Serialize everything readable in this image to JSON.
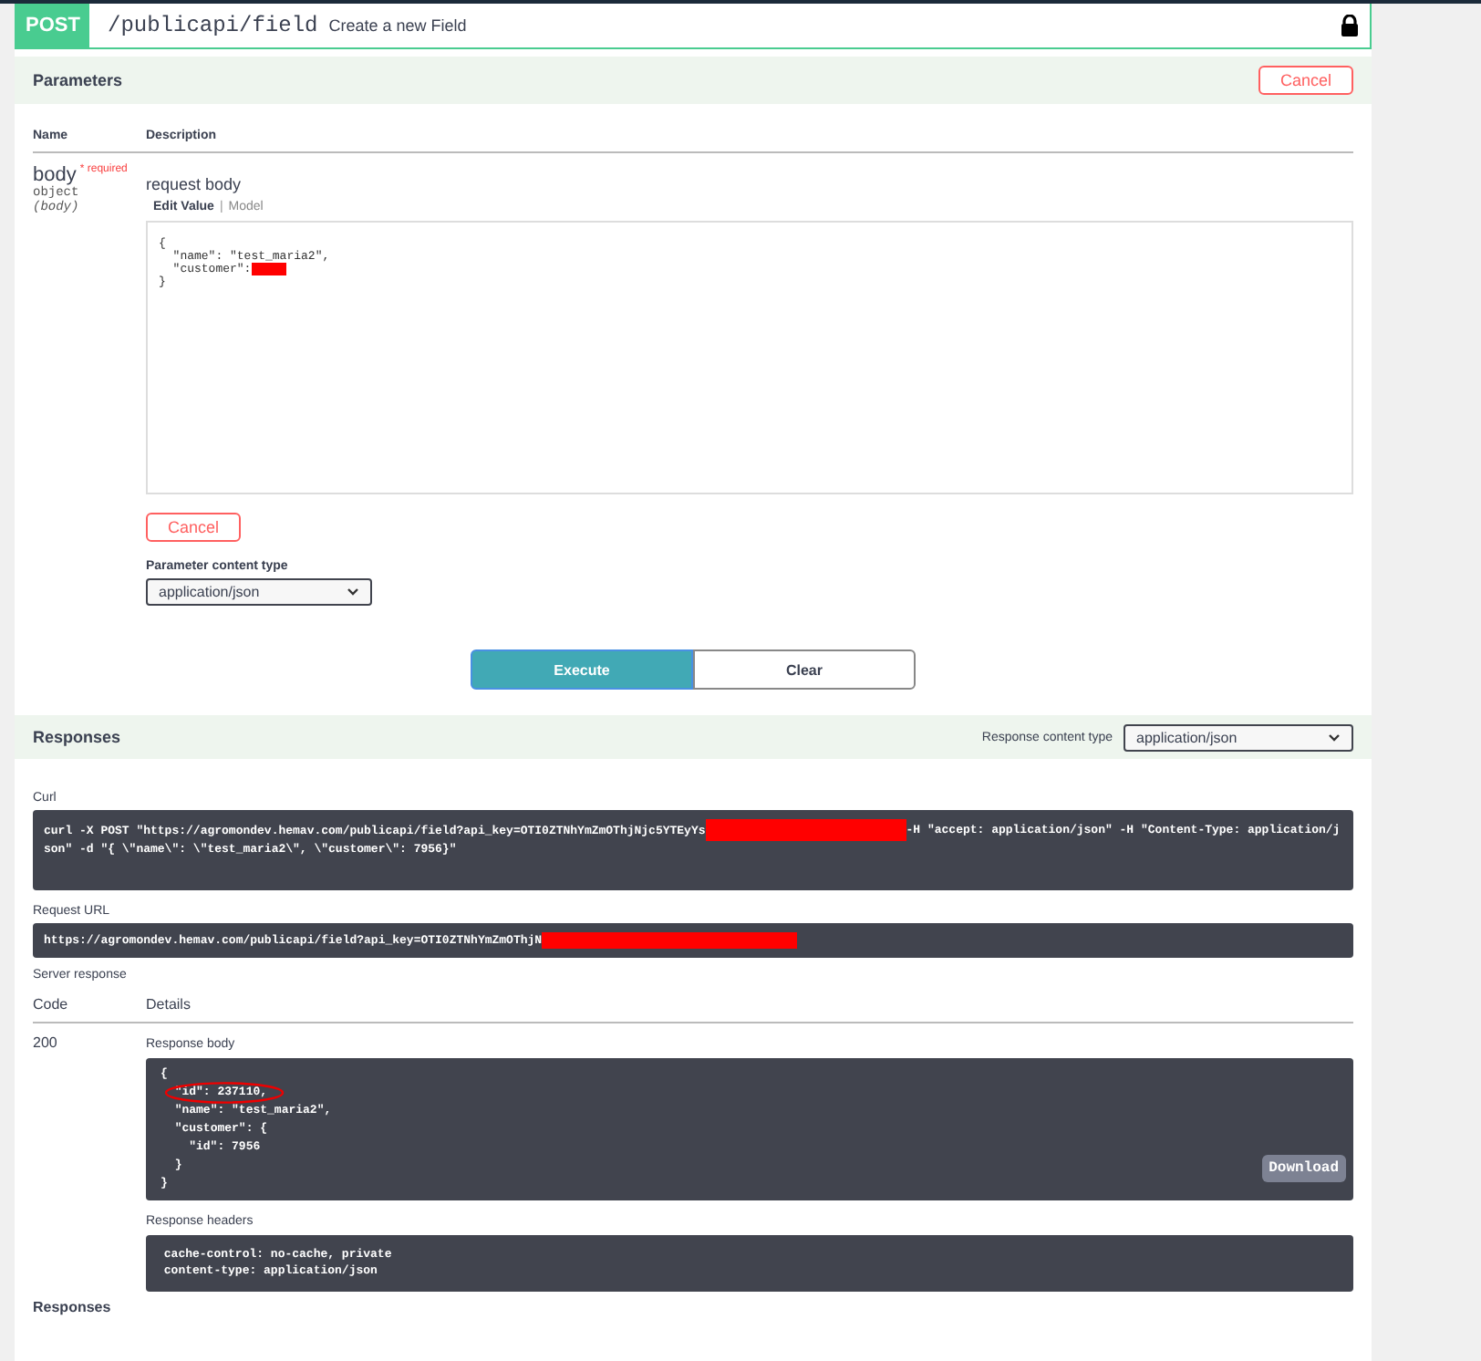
{
  "operation": {
    "method": "POST",
    "path": "/publicapi/field",
    "summary": "Create a new Field",
    "locked": true
  },
  "parameters": {
    "title": "Parameters",
    "cancel": "Cancel",
    "columns": [
      "Name",
      "Description"
    ],
    "items": [
      {
        "name": "body",
        "required_mark": "* required",
        "type": "object",
        "in": "(body)",
        "description": "request body",
        "tabs": [
          {
            "label": "Edit Value",
            "selected": true
          },
          {
            "label": "Model",
            "selected": false
          }
        ],
        "tab_separator": "|",
        "value_lines": [
          {
            "text": "{",
            "redacted": false
          },
          {
            "text": "  \"name\": \"test_maria2\",",
            "redacted": false
          },
          {
            "text": "  \"customer\":",
            "redacted": true
          },
          {
            "text": "}",
            "redacted": false
          }
        ],
        "cancel": "Cancel",
        "content_type_label": "Parameter content type",
        "content_type": "application/json"
      }
    ]
  },
  "actions": [
    {
      "label": "Execute",
      "kind": "primary"
    },
    {
      "label": "Clear",
      "kind": "secondary"
    }
  ],
  "responses": {
    "title": "Responses",
    "content_type_label": "Response content type",
    "content_type": "application/json",
    "curl_label": "Curl",
    "curl": [
      {
        "text": "curl -X POST \"https://agromondev.hemav.com/publicapi/field?api_key=OTI0ZTNhYmZmOThjNjc5YTEyYs",
        "redacted": true
      },
      {
        "text": "-H \"accept: application/json\" -H \"Content-Type: application/json\" -d \"{ \\\"name\\\": \\\"test_maria2\\\", \\\"customer\\\": 7956}\"",
        "redacted": false
      }
    ],
    "url_label": "Request URL",
    "url": {
      "text": "https://agromondev.hemav.com/publicapi/field?api_key=OTI0ZTNhYmZmOThjN",
      "redacted": true
    },
    "server_label": "Server response",
    "columns": [
      "Code",
      "Details"
    ],
    "code": "200",
    "body_label": "Response body",
    "body_lines": [
      "{",
      "  \"id\": 237110,",
      "  \"name\": \"test_maria2\",",
      "  \"customer\": {",
      "    \"id\": 7956",
      "  }",
      "}"
    ],
    "annotated": true,
    "download": "Download",
    "headers_label": "Response headers",
    "header_lines": [
      " cache-control: no-cache, private ",
      " content-type: application/json "
    ]
  },
  "footer_title": "Responses"
}
